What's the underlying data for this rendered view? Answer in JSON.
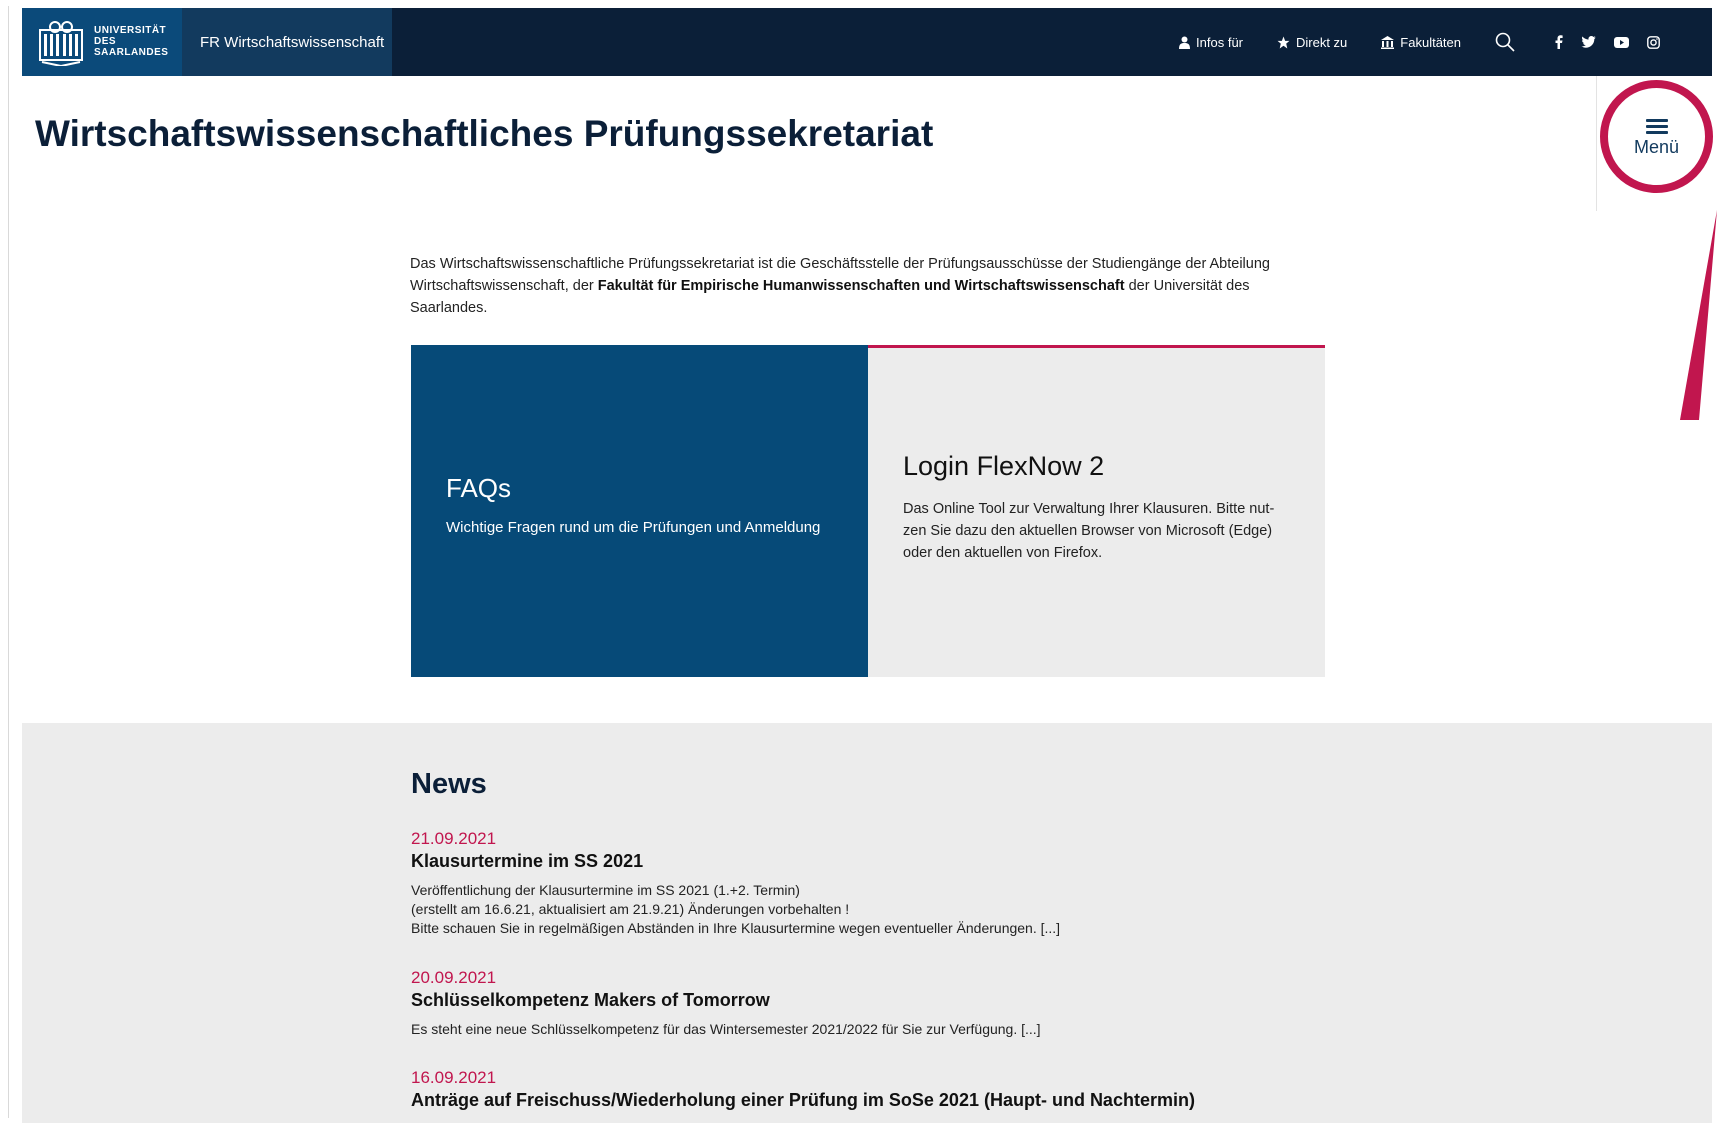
{
  "header": {
    "logo_lines": [
      "UNIVERSITÄT",
      "DES",
      "SAARLANDES"
    ],
    "faculty": "FR Wirtschaftswissenschaft",
    "nav": [
      "Infos für",
      "Direkt zu",
      "Fakultäten"
    ]
  },
  "page": {
    "title": "Wirtschaftswissenschaftliches Prüfungssekretariat"
  },
  "menu": {
    "label": "Menü"
  },
  "intro": {
    "part1": "Das Wirtschaftswissenschaftliche Prüfungssekretariat ist die Geschäftsstelle der Prüfungsausschüsse der Studiengänge der Abteilung Wirtschaftswissenschaft, der ",
    "bold": "Fakultät für Empirische Humanwissenschaften und Wirtschaftswissenschaft",
    "part2": " der Universität des Saarlandes."
  },
  "tiles": [
    {
      "title": "FAQs",
      "desc": "Wichtige Fragen rund um die Prüfungen und Anmeldung"
    },
    {
      "title": "Login FlexNow 2",
      "desc": "Das Online Tool zur Verwaltung Ihrer Klausuren. Bitte nut-zen Sie dazu den aktuellen Browser von Microsoft (Edge) oder den aktuellen von Firefox."
    }
  ],
  "news": {
    "title": "News",
    "items": [
      {
        "date": "21.09.2021",
        "headline": "Klausurtermine im SS 2021",
        "lines": [
          "Veröffentlichung der Klausurtermine im SS 2021 (1.+2. Termin)",
          "(erstellt am 16.6.21, aktualisiert am 21.9.21) Änderungen vorbehalten !",
          "Bitte schauen Sie in regelmäßigen Abständen in Ihre Klausurtermine wegen eventueller Änderungen. [...]"
        ]
      },
      {
        "date": "20.09.2021",
        "headline": "Schlüsselkompetenz Makers of Tomorrow",
        "lines": [
          "Es steht eine neue Schlüsselkompetenz für das Wintersemester 2021/2022 für Sie zur Verfügung. [...]"
        ]
      },
      {
        "date": "16.09.2021",
        "headline": "Anträge auf Freischuss/Wiederholung einer Prüfung im SoSe 2021 (Haupt- und Nachtermin)",
        "lines": []
      }
    ]
  },
  "colors": {
    "navy": "#0b1f38",
    "blue": "#064a78",
    "accent": "#c1164e",
    "gray": "#ececec"
  },
  "icons": [
    "university-logo-icon",
    "user-icon",
    "star-icon",
    "building-icon",
    "search-icon",
    "facebook-icon",
    "twitter-icon",
    "youtube-icon",
    "instagram-icon",
    "hamburger-icon",
    "arrow-annotation-icon"
  ]
}
